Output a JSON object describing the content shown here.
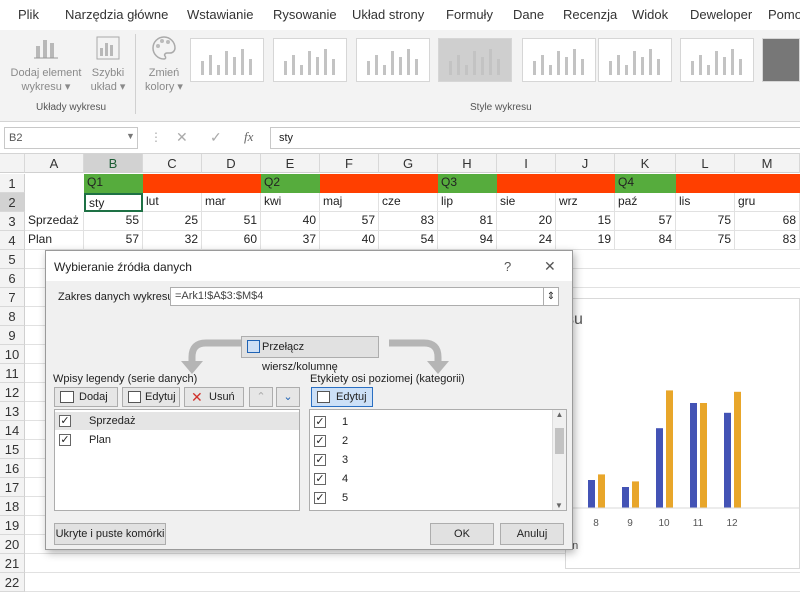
{
  "menu": [
    "Plik",
    "Narzędzia główne",
    "Wstawianie",
    "Rysowanie",
    "Układ strony",
    "Formuły",
    "Dane",
    "Recenzja",
    "Widok",
    "Deweloper",
    "Pomoc"
  ],
  "ribbon": {
    "add_element": [
      "Dodaj element",
      "wykresu ▾"
    ],
    "quick_layout": [
      "Szybki",
      "układ ▾"
    ],
    "change_colors": [
      "Zmień",
      "kolory ▾"
    ],
    "group_layouts": "Układy wykresu",
    "group_styles": "Style wykresu"
  },
  "formula_bar": {
    "name_box": "B2",
    "fx": "fx",
    "value": "sty"
  },
  "columns": [
    "A",
    "B",
    "C",
    "D",
    "E",
    "F",
    "G",
    "H",
    "I",
    "J",
    "K",
    "L",
    "M"
  ],
  "rows": [
    "1",
    "2",
    "3",
    "4",
    "5",
    "6",
    "7",
    "8",
    "9",
    "10",
    "11",
    "12",
    "13",
    "14",
    "15",
    "16",
    "17",
    "18",
    "19",
    "20",
    "21",
    "22"
  ],
  "sheet": {
    "quarters": [
      "Q1",
      "Q2",
      "Q3",
      "Q4"
    ],
    "months": [
      "sty",
      "lut",
      "mar",
      "kwi",
      "maj",
      "cze",
      "lip",
      "sie",
      "wrz",
      "paź",
      "lis",
      "gru"
    ],
    "row3_label": "Sprzedaż",
    "row3": [
      "55",
      "25",
      "51",
      "40",
      "57",
      "83",
      "81",
      "20",
      "15",
      "57",
      "75",
      "68"
    ],
    "row4_label": "Plan",
    "row4": [
      "57",
      "32",
      "60",
      "37",
      "40",
      "54",
      "94",
      "24",
      "19",
      "84",
      "75",
      "83"
    ],
    "colors": {
      "green": "#56ac3d",
      "red": "#ff3f00"
    }
  },
  "chart": {
    "title_fragment": "su",
    "axis_fragment": "on",
    "colors": {
      "series1": "#4353b5",
      "series2": "#e8a62a"
    },
    "chart_data": {
      "type": "bar",
      "categories": [
        "8",
        "9",
        "10",
        "11",
        "12"
      ],
      "series": [
        {
          "name": "Sprzedaż",
          "values": [
            20,
            15,
            57,
            75,
            68
          ]
        },
        {
          "name": "Plan",
          "values": [
            24,
            19,
            84,
            75,
            83
          ]
        }
      ],
      "ylim": [
        0,
        100
      ]
    }
  },
  "dialog": {
    "title": "Wybieranie źródła danych",
    "help": "?",
    "close": "✕",
    "range_label": "Zakres danych wykresu:",
    "range_value": "=Ark1!$A$3:$M$4",
    "switch_button": "Przełącz wiersz/kolumnę",
    "legend_label": "Wpisy legendy (serie danych)",
    "axis_label": "Etykiety osi poziomej (kategorii)",
    "add": "Dodaj",
    "edit": "Edytuj",
    "remove": "Usuń",
    "edit_axis": "Edytuj",
    "series": [
      "Sprzedaż",
      "Plan"
    ],
    "categories": [
      "1",
      "2",
      "3",
      "4",
      "5"
    ],
    "hidden_cells": "Ukryte i puste komórki",
    "ok": "OK",
    "cancel": "Anuluj"
  }
}
